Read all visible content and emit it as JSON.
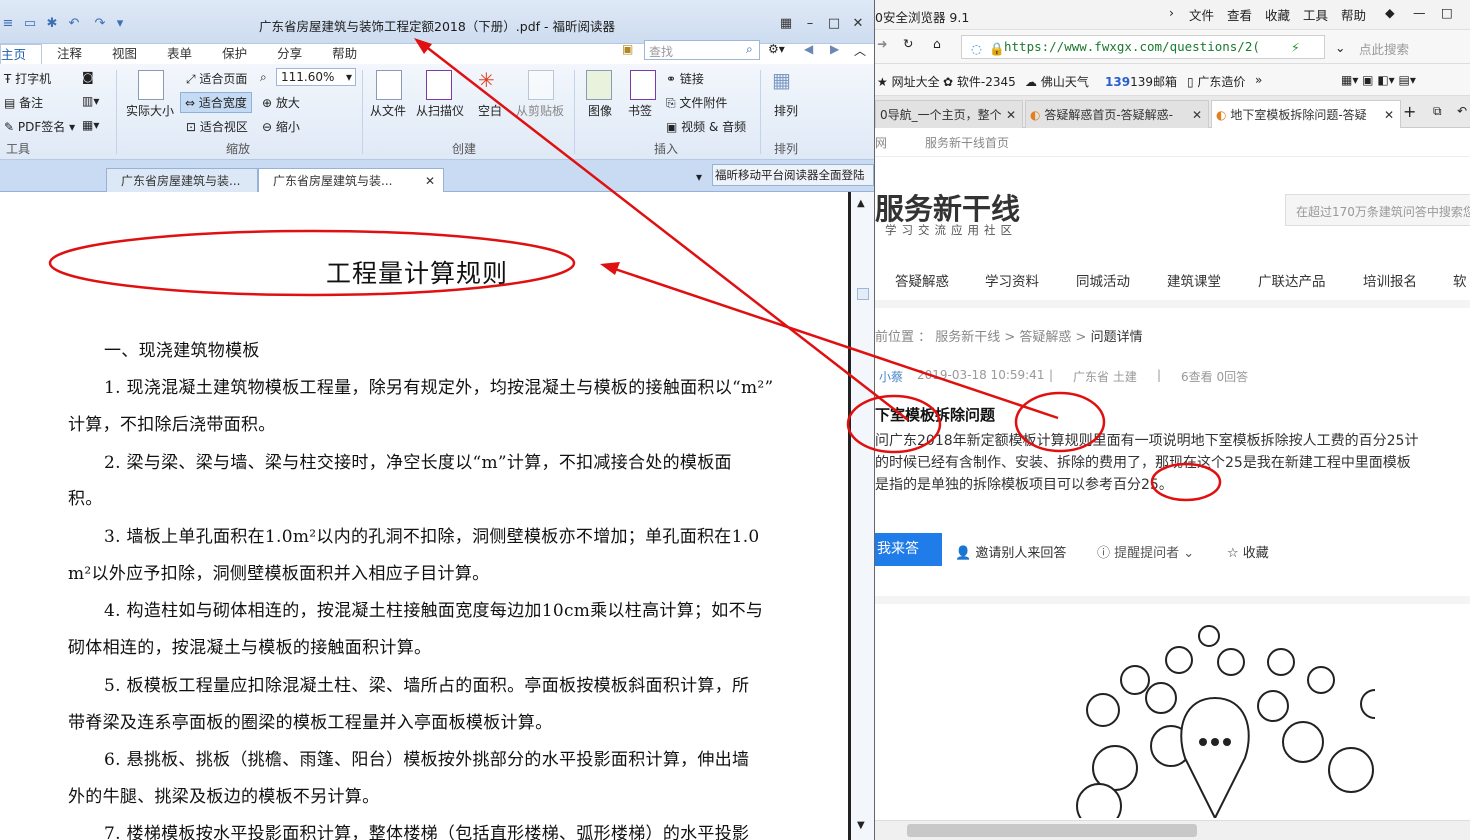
{
  "pdf": {
    "title": "广东省房屋建筑与装饰工程定额2018（下册）.pdf - 福昕阅读器",
    "menu_tabs": [
      "主页",
      "注释",
      "视图",
      "表单",
      "保护",
      "分享",
      "帮助"
    ],
    "search_placeholder": "查找",
    "ribbon": {
      "tools": [
        "打字机",
        "备注",
        "PDF签名"
      ],
      "tools_group": "工具",
      "actual_size": "实际大小",
      "fit_page": "适合页面",
      "fit_width": "适合宽度",
      "fit_area": "适合视区",
      "zoom_value": "111.60%",
      "zoom_in": "放大",
      "zoom_out": "缩小",
      "zoom_group": "缩放",
      "from_file": "从文件",
      "from_scanner": "从扫描仪",
      "blank": "空白",
      "from_clipboard": "从剪贴板",
      "create_group": "创建",
      "image": "图像",
      "bookmark": "书签",
      "link": "链接",
      "attachment": "文件附件",
      "video_audio": "视频 & 音频",
      "insert_group": "插入",
      "arrange": "排列",
      "arrange_group": "排列"
    },
    "doc_tabs": [
      "广东省房屋建筑与装...",
      "广东省房屋建筑与装..."
    ],
    "promo": "福昕移动平台阅读器全面登陆",
    "page": {
      "heading": "工程量计算规则",
      "lines": [
        "一、现浇建筑物模板",
        "1. 现浇混凝土建筑物模板工程量，除另有规定外，均按混凝土与模板的接触面积以“m²”",
        "计算，不扣除后浇带面积。",
        "2. 梁与梁、梁与墙、梁与柱交接时，净空长度以“m”计算，不扣减接合处的模板面",
        "积。",
        "3. 墙板上单孔面积在1.0m²以内的孔洞不扣除，洞侧壁模板亦不增加；单孔面积在1.0",
        "m²以外应予扣除，洞侧壁模板面积并入相应子目计算。",
        "4. 构造柱如与砌体相连的，按混凝土柱接触面宽度每边加10cm乘以柱高计算；如不与",
        "砌体相连的，按混凝土与模板的接触面积计算。",
        "5. 板模板工程量应扣除混凝土柱、梁、墙所占的面积。亭面板按模板斜面积计算，所",
        "带脊梁及连系亭面板的圈梁的模板工程量并入亭面板模板计算。",
        "6. 悬挑板、挑板（挑檐、雨篷、阳台）模板按外挑部分的水平投影面积计算，伸出墙",
        "外的牛腿、挑梁及板边的模板不另计算。",
        "7. 楼梯模板按水平投影面积计算，整体楼梯（包括直形楼梯、弧形楼梯）的水平投影"
      ]
    }
  },
  "browser": {
    "title": "0安全浏览器 9.1",
    "menus": [
      "文件",
      "查看",
      "收藏",
      "工具",
      "帮助"
    ],
    "url": "https://www.fwxgx.com/questions/2(",
    "search_placeholder": "点此搜索",
    "bookmarks": [
      "网址大全",
      "软件-2345",
      "佛山天气",
      "139邮箱",
      "广东造价"
    ],
    "tabs": [
      "0导航_一个主页，整个",
      "答疑解惑首页-答疑解惑-",
      "地下室模板拆除问题-答疑"
    ],
    "site": {
      "top_links": [
        "网",
        "服务新干线首页"
      ],
      "logo": "服务新干线",
      "slogan": "学习交流应用社区",
      "search_placeholder": "在超过170万条建筑问答中搜索您",
      "nav": [
        "答疑解惑",
        "学习资料",
        "同城活动",
        "建筑课堂",
        "广联达产品",
        "培训报名",
        "软"
      ],
      "breadcrumb": "前位置 ： 服务新干线 > 答疑解惑 > ",
      "breadcrumb_current": "问题详情",
      "author": "小蔡",
      "time": "2019-03-18 10:59:41",
      "region": "广东省  土建",
      "stats": "6查看  0回答",
      "question_title": "下室模板拆除问题",
      "question_lines": [
        "问广东2018年新定额模板计算规则里面有一项说明地下室模板拆除按人工费的百分25计",
        "的时候已经有含制作、安装、拆除的费用了，那现在这个25是我在新建工程中里面模板",
        "是指的是单独的拆除模板项目可以参考百分25。"
      ],
      "answer_btn": "我来答",
      "invite": "邀请别人来回答",
      "remind": "提醒提问者",
      "favorite": "收藏"
    }
  },
  "colors": {
    "annotation": "#e01010",
    "accent": "#1f7ce8",
    "ribbon": "#dfe9f6"
  }
}
